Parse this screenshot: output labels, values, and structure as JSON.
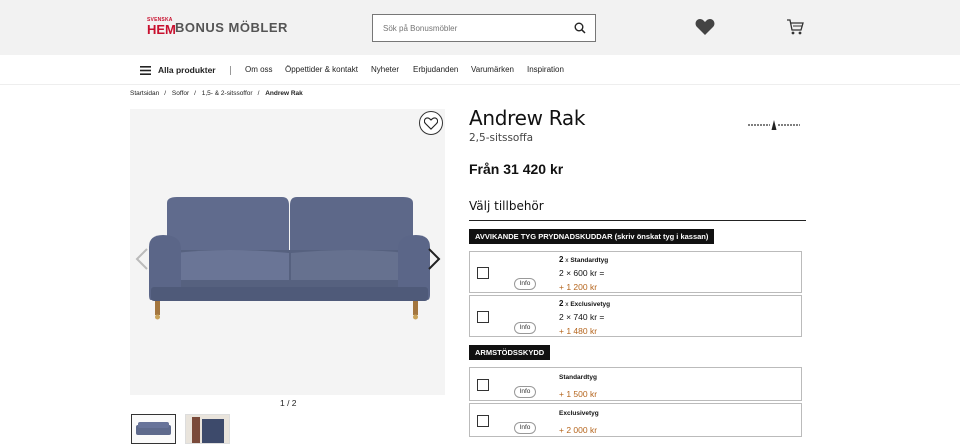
{
  "header": {
    "logo_small": "SVENSKA",
    "logo_hem": "HEM",
    "logo_text": "BONUS MÖBLER",
    "search_placeholder": "Sök på Bonusmöbler"
  },
  "nav": {
    "all_products": "Alla produkter",
    "items": [
      "Om oss",
      "Öppettider & kontakt",
      "Nyheter",
      "Erbjudanden",
      "Varumärken",
      "Inspiration"
    ]
  },
  "breadcrumb": [
    "Startsidan",
    "Soffor",
    "1,5- & 2-sitssoffor",
    "Andrew Rak"
  ],
  "gallery": {
    "pager": "1 / 2"
  },
  "product": {
    "title": "Andrew Rak",
    "subtitle": "2,5-sitssoffa",
    "price": "Från 31 420 kr",
    "accessories_title": "Välj tillbehör"
  },
  "sections": [
    {
      "label": "AVVIKANDE TYG PRYDNADSKUDDAR (skriv önskat tyg i kassan)",
      "options": [
        {
          "qty": "2",
          "kind": "Standardtyg",
          "calc": "2 × 600 kr =",
          "price": "+ 1 200 kr",
          "info": "Info"
        },
        {
          "qty": "2",
          "kind": "Exclusivetyg",
          "calc": "2 × 740 kr =",
          "price": "+ 1 480 kr",
          "info": "Info"
        }
      ]
    },
    {
      "label": "ARMSTÖDSSKYDD",
      "options": [
        {
          "name": "Standardtyg",
          "price": "+ 1 500 kr",
          "info": "Info"
        },
        {
          "name": "Exclusivetyg",
          "price": "+ 2 000 kr",
          "info": "Info"
        }
      ]
    }
  ],
  "colors": {
    "accent_price": "#b5651d",
    "brand_red": "#c8102e",
    "sofa": "#5e6a8c"
  }
}
